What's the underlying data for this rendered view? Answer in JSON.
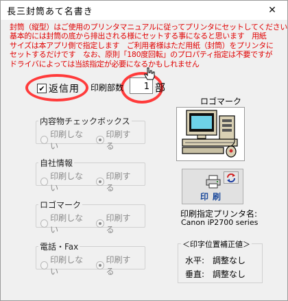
{
  "window": {
    "title": "長三封筒あて名書き",
    "close_icon": "close-icon"
  },
  "notice": {
    "color": "#e00000",
    "lines": [
      "封筒（縦型）はご使用のプリンタマニュアルに従ってプリンタにセットしてください",
      "基本的には封筒の底から排出される様にセットする事になると思います　用紙",
      "サイズは本アプリ側で指定します　ご利用者様はただ用紙（封筒）をプリンタに",
      "セットするだけです　なお、原則「180度回転」のプロパティ指定は不要ですが",
      "ドライバによっては当該指定が必要になるかもしれません"
    ]
  },
  "henshin": {
    "label": "返信用",
    "checked": true
  },
  "copies": {
    "label": "印刷部数",
    "value": "1",
    "unit": "部"
  },
  "groups": [
    {
      "title": "内容物チェックボックス",
      "options": [
        "印刷しない",
        "印刷する"
      ],
      "selected": 1
    },
    {
      "title": "自社情報",
      "options": [
        "印刷しない",
        "印刷する"
      ],
      "selected": 1
    },
    {
      "title": "ロゴマーク",
      "options": [
        "印刷しない",
        "印刷する"
      ],
      "selected": 1
    },
    {
      "title": "電話・Fax",
      "options": [
        "印刷しない",
        "印刷する"
      ],
      "selected": 1
    }
  ],
  "logo": {
    "title": "ロゴマーク",
    "icon": "computer-logo-icon"
  },
  "print_button": {
    "label": "印刷",
    "icon": "printer-icon"
  },
  "swap_button": {
    "icon": "swap-arrows-icon"
  },
  "printer": {
    "label": "印刷指定プリンタ名:",
    "name": "Canon iP2700 series"
  },
  "adjust": {
    "title": "＜印字位置補正値＞",
    "horizontal": "水平:　調整なし",
    "vertical": "垂直:　調整なし"
  },
  "highlight_color": "#ff3b3b"
}
